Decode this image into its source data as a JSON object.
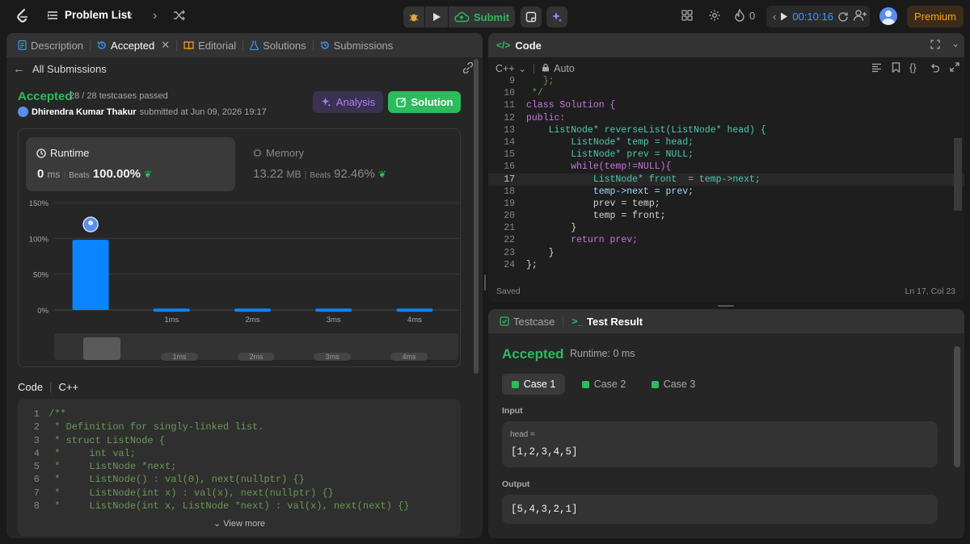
{
  "topbar": {
    "problem_list": "Problem List",
    "submit": "Submit",
    "streak": "0",
    "timer": "00:10:16",
    "premium": "Premium"
  },
  "left": {
    "tabs": [
      {
        "label": "Description"
      },
      {
        "label": "Accepted"
      },
      {
        "label": "Editorial"
      },
      {
        "label": "Solutions"
      },
      {
        "label": "Submissions"
      }
    ],
    "back": "All Submissions",
    "status": "Accepted",
    "passed": "28 / 28 testcases passed",
    "user": "Dhirendra Kumar Thakur",
    "submitted": "submitted at Jun 09, 2026 19:17",
    "analysis": "Analysis",
    "solution": "Solution",
    "runtime": {
      "title": "Runtime",
      "value": "0",
      "unit": "ms",
      "beats_label": "Beats",
      "beats": "100.00%"
    },
    "memory": {
      "title": "Memory",
      "value": "13.22",
      "unit": "MB",
      "beats_label": "Beats",
      "beats": "92.46%"
    },
    "code_label": "Code",
    "lang": "C++",
    "view_more": "View more",
    "code": [
      {
        "n": "1",
        "t": "/**"
      },
      {
        "n": "2",
        "t": " * Definition for singly-linked list."
      },
      {
        "n": "3",
        "t": " * struct ListNode {"
      },
      {
        "n": "4",
        "t": " *     int val;"
      },
      {
        "n": "5",
        "t": " *     ListNode *next;"
      },
      {
        "n": "6",
        "t": " *     ListNode() : val(0), next(nullptr) {}"
      },
      {
        "n": "7",
        "t": " *     ListNode(int x) : val(x), next(nullptr) {}"
      },
      {
        "n": "8",
        "t": " *     ListNode(int x, ListNode *next) : val(x), next(next) {}"
      }
    ]
  },
  "chart_data": {
    "type": "bar",
    "categories": [
      "",
      "1ms",
      "2ms",
      "3ms",
      "4ms"
    ],
    "values": [
      98,
      2,
      2,
      2,
      2
    ],
    "ylim": [
      0,
      150
    ],
    "yticks": [
      "0%",
      "50%",
      "100%",
      "150%"
    ],
    "grid": true,
    "nav_labels": [
      "1ms",
      "2ms",
      "3ms",
      "4ms"
    ]
  },
  "editor": {
    "title": "Code",
    "lang": "C++",
    "mode": "Auto",
    "saved": "Saved",
    "cursor": "Ln 17, Col 23",
    "lines": [
      {
        "n": "9",
        "t": "   };"
      },
      {
        "n": "10",
        "t": " */"
      },
      {
        "n": "11",
        "t": "class Solution {"
      },
      {
        "n": "12",
        "t": "public:"
      },
      {
        "n": "13",
        "t": "    ListNode* reverseList(ListNode* head) {"
      },
      {
        "n": "14",
        "t": "        ListNode* temp = head;"
      },
      {
        "n": "15",
        "t": "        ListNode* prev = NULL;"
      },
      {
        "n": "16",
        "t": "        while(temp!=NULL){"
      },
      {
        "n": "17",
        "t": "            ListNode* front  = temp->next;"
      },
      {
        "n": "18",
        "t": "            temp->next = prev;"
      },
      {
        "n": "19",
        "t": "            prev = temp;"
      },
      {
        "n": "20",
        "t": "            temp = front;"
      },
      {
        "n": "21",
        "t": "        }"
      },
      {
        "n": "22",
        "t": "        return prev;"
      },
      {
        "n": "23",
        "t": "    }"
      },
      {
        "n": "24",
        "t": "};"
      }
    ]
  },
  "result": {
    "tab_testcase": "Testcase",
    "tab_result": "Test Result",
    "status": "Accepted",
    "runtime": "Runtime: 0 ms",
    "cases": [
      {
        "label": "Case 1"
      },
      {
        "label": "Case 2"
      },
      {
        "label": "Case 3"
      }
    ],
    "input_label": "Input",
    "var": "head =",
    "input": "[1,2,3,4,5]",
    "output_label": "Output",
    "output": "[5,4,3,2,1]"
  },
  "colors": {
    "accent_green": "#2cbb5d",
    "bar_blue": "#0a84ff",
    "orange": "#ffa116",
    "purple": "#c48bf5"
  }
}
